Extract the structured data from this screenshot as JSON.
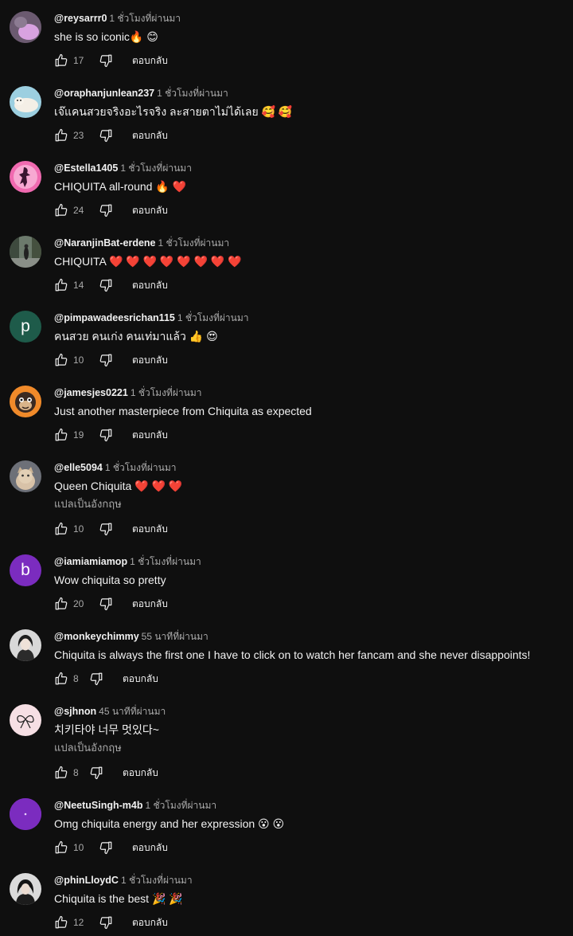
{
  "labels": {
    "reply": "ตอบกลับ",
    "translate": "แปลเป็นอังกฤษ"
  },
  "comments": [
    {
      "author": "@reysarrr0",
      "time": "1 ชั่วโมงที่ผ่านมา",
      "text": "she is so iconic🔥 😊",
      "likes": "17",
      "avatar": "purple-blob-photo",
      "avatar_color": "#d8a2e0"
    },
    {
      "author": "@oraphanjunlean237",
      "time": "1 ชั่วโมงที่ผ่านมา",
      "text": "เจ๊แคนสวยจริงอะไรจริง ละสายตาไม่ได้เลย 🥰 🥰",
      "likes": "23",
      "avatar": "seal-photo",
      "avatar_color": "#cfe6ef"
    },
    {
      "author": "@Estella1405",
      "time": "1 ชั่วโมงที่ผ่านมา",
      "text": "CHIQUITA all-round 🔥 ❤️",
      "likes": "24",
      "avatar": "pink-silhouette",
      "avatar_color": "#f06ab0"
    },
    {
      "author": "@NaranjinBat-erdene",
      "time": "1 ชั่วโมงที่ผ่านมา",
      "text": "CHIQUITA ❤️ ❤️ ❤️ ❤️ ❤️ ❤️ ❤️ ❤️",
      "likes": "14",
      "avatar": "street-photo",
      "avatar_color": "#4b5a4c"
    },
    {
      "author": "@pimpawadeesrichan115",
      "time": "1 ชั่วโมงที่ผ่านมา",
      "text": "คนสวย คนเก่ง คนเท่มาแล้ว 👍 😍",
      "likes": "10",
      "avatar": "letter-p",
      "avatar_letter": "p",
      "avatar_color": "#1e5b4a"
    },
    {
      "author": "@jamesjes0221",
      "time": "1 ชั่วโมงที่ผ่านมา",
      "text": "Just another masterpiece from Chiquita as expected",
      "likes": "19",
      "avatar": "monkey-cartoon",
      "avatar_color": "#f08a2a"
    },
    {
      "author": "@elle5094",
      "time": "1 ชั่วโมงที่ผ่านมา",
      "text": "Queen Chiquita ❤️ ❤️ ❤️",
      "likes": "10",
      "avatar": "cat-photo",
      "avatar_color": "#8a8c92",
      "translate": true
    },
    {
      "author": "@iamiamiamop",
      "time": "1 ชั่วโมงที่ผ่านมา",
      "text": "Wow chiquita  so pretty",
      "likes": "20",
      "avatar": "letter-b",
      "avatar_letter": "b",
      "avatar_color": "#7b2cbf"
    },
    {
      "author": "@monkeychimmy",
      "time": "55 นาทีที่ผ่านมา",
      "text": "Chiquita is always the first one I have to click on to watch her fancam and she never disappoints!",
      "likes": "8",
      "avatar": "portrait-photo",
      "avatar_color": "#cfcfcf"
    },
    {
      "author": "@sjhnon",
      "time": "45 นาทีที่ผ่านมา",
      "text": "치키타야 너무 멋있다~",
      "likes": "8",
      "avatar": "ribbon-drawing",
      "avatar_color": "#f5dde3",
      "translate": true
    },
    {
      "author": "@NeetuSingh-m4b",
      "time": "1 ชั่วโมงที่ผ่านมา",
      "text": "Omg chiquita energy and her expression 😮 😮",
      "likes": "10",
      "avatar": "purple-dot",
      "avatar_color": "#7b2cbf"
    },
    {
      "author": "@phinLloydC",
      "time": "1 ชั่วโมงที่ผ่านมา",
      "text": "Chiquita is the best 🎉 🎉",
      "likes": "12",
      "avatar": "portrait-photo-2",
      "avatar_color": "#d0d0d0"
    }
  ]
}
